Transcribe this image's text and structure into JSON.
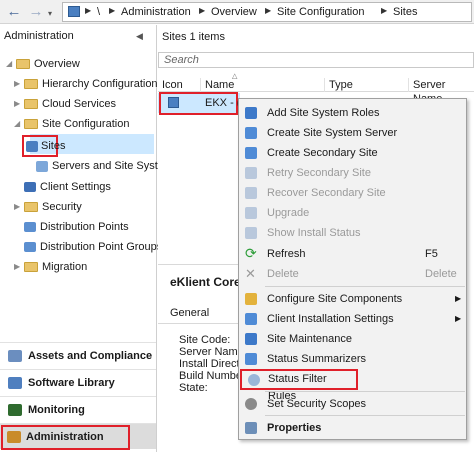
{
  "breadcrumb": {
    "items": [
      "\\",
      "Administration",
      "Overview",
      "Site Configuration",
      "Sites"
    ]
  },
  "nav": {
    "back_icon": "back-arrow-icon",
    "forward_icon": "forward-arrow-icon"
  },
  "left": {
    "header": "Administration",
    "tree": {
      "overview": "Overview",
      "hierarchy": "Hierarchy Configuration",
      "cloud": "Cloud Services",
      "siteconfig": "Site Configuration",
      "sites": "Sites",
      "servers": "Servers and Site System",
      "client_settings": "Client Settings",
      "security": "Security",
      "dist_points": "Distribution Points",
      "dist_groups": "Distribution Point Groups",
      "migration": "Migration"
    },
    "workspaces": {
      "assets": "Assets and Compliance",
      "software": "Software Library",
      "monitoring": "Monitoring",
      "administration": "Administration"
    }
  },
  "main": {
    "title": "Sites 1 items",
    "search_placeholder": "Search",
    "columns": [
      "Icon",
      "Name",
      "Type",
      "Server Name"
    ],
    "row": {
      "name": "EKX - ("
    },
    "detail": {
      "title": "eKlient Core S",
      "general": "General",
      "fields": [
        "Site Code:",
        "Server Name:",
        "Install Directo",
        "Build Number",
        "State:"
      ]
    }
  },
  "menu": {
    "add_roles": "Add Site System Roles",
    "create_server": "Create Site System Server",
    "create_secondary": "Create Secondary Site",
    "retry_secondary": "Retry Secondary Site",
    "recover_secondary": "Recover Secondary Site",
    "upgrade": "Upgrade",
    "show_install": "Show Install Status",
    "refresh": "Refresh",
    "refresh_key": "F5",
    "delete": "Delete",
    "delete_key": "Delete",
    "configure_components": "Configure Site Components",
    "client_install": "Client Installation Settings",
    "site_maintenance": "Site Maintenance",
    "status_summarizers": "Status Summarizers",
    "status_filter": "Status Filter Rules",
    "security_scopes": "Set Security Scopes",
    "properties": "Properties"
  },
  "colors": {
    "highlight_red": "#e0202a",
    "selection": "#cce8ff"
  }
}
